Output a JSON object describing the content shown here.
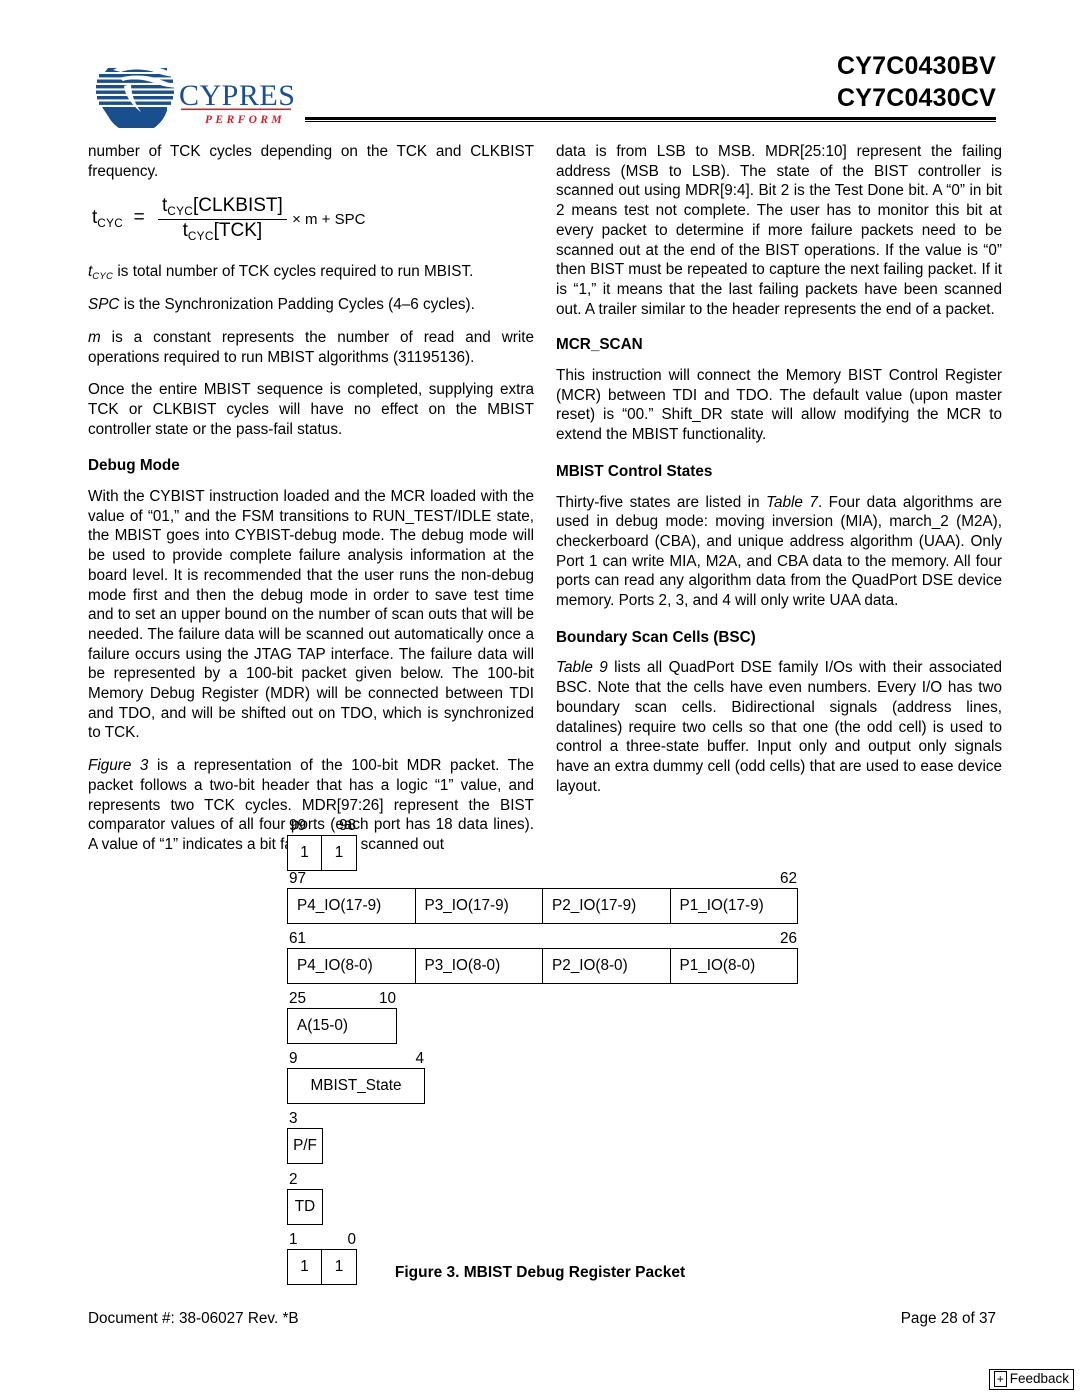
{
  "header": {
    "logo_name": "cypress-logo",
    "logo_wordmark": "CYPRESS",
    "logo_tagline": "PERFORM",
    "title_line1": "CY7C0430BV",
    "title_line2": "CY7C0430CV",
    "brand_blue": "#1a4f8f",
    "brand_red": "#d62027"
  },
  "left_column": {
    "para_intro": "number of TCK cycles depending on the TCK and CLKBIST frequency.",
    "formula": {
      "lhs": "t",
      "lhs_sub": "CYC",
      "equals": "=",
      "numerator": "t",
      "numerator_sub": "CYC",
      "numerator_rest": "[CLKBIST]",
      "denominator": "t",
      "denominator_sub": "CYC",
      "denominator_rest": "[TCK]",
      "tail": "× m + SPC"
    },
    "para_tcyc_def_ital": "t",
    "para_tcyc_def_sub": "CYC",
    "para_tcyc_def_rest": " is total number of TCK cycles required to run MBIST.",
    "para_spc_ital": "SPC",
    "para_spc_rest": " is the Synchronization Padding Cycles (4–6 cycles).",
    "para_m_ital": "m",
    "para_m_rest": " is a constant represents the number of read and write operations required to run MBIST algorithms (31195136).",
    "para_once": "Once the entire MBIST sequence is completed, supplying extra TCK or CLKBIST cycles will have no effect on the MBIST controller state or the pass-fail status.",
    "heading_debug_mode": "Debug Mode",
    "para_debug": "With the CYBIST instruction loaded and the MCR loaded with the value of “01,” and the FSM transitions to RUN_TEST/IDLE state, the MBIST goes into CYBIST-debug mode. The debug mode will be used to provide complete failure analysis information at the board level. It is recommended that the user runs the non-debug mode first and then the debug mode in order to save test time and to set an upper bound on the number of scan outs that will be needed. The failure data will be scanned out automatically once a failure occurs using the JTAG TAP interface. The failure data will be represented by a 100-bit packet given below. The 100-bit Memory Debug Register (MDR) will be connected between TDI and TDO, and will be shifted out on TDO, which is synchronized to TCK.",
    "para_figure3_ital": "Figure 3",
    "para_figure3_rest": " is a representation of the 100-bit MDR packet. The packet follows a two-bit header that has a logic “1” value, and represents two TCK cycles. MDR[97:26] represent the BIST comparator values of all four ports (each port has 18 data lines). A value of “1” indicates a bit failure. The scanned out"
  },
  "right_column": {
    "para_continued": "data is from LSB to MSB. MDR[25:10] represent the failing address (MSB to LSB). The state of the BIST controller is scanned out using MDR[9:4]. Bit 2 is the Test Done bit. A “0” in bit 2 means test not complete. The user has to monitor this bit at every packet to determine if more failure packets need to be scanned out at the end of the BIST operations. If the value is “0” then BIST must be repeated to capture the next failing packet. If it is “1,” it means that the last failing packets have been scanned out. A trailer similar to the header represents the end of a packet.",
    "heading_mcr_scan": "MCR_SCAN",
    "para_mcr_scan": "This instruction will connect the Memory BIST Control Register (MCR) between TDI and TDO. The default value (upon master reset) is “00.” Shift_DR state will allow modifying the MCR to extend the MBIST functionality.",
    "heading_mbist_control": "MBIST Control States",
    "para_mbist_control_pre": "Thirty-five states are listed in ",
    "para_mbist_control_ital": "Table 7",
    "para_mbist_control_rest": ". Four data algorithms are used in debug mode: moving inversion (MIA), march_2 (M2A), checkerboard (CBA), and unique address algorithm (UAA). Only Port 1 can write MIA, M2A, and CBA data to the memory. All four ports can read any algorithm data from the QuadPort DSE device memory. Ports 2, 3, and 4 will only write UAA data.",
    "heading_bsc": "Boundary Scan Cells (BSC)",
    "para_bsc_ital": "Table 9",
    "para_bsc_rest": " lists all QuadPort DSE family I/Os with their associated BSC. Note that the cells have even numbers. Every I/O has two boundary scan cells. Bidirectional signals (address lines, datalines) require two cells so that one (the odd cell) is used to control a three-state buffer. Input only and output only signals have an extra dummy cell (odd cells) that are used to ease device layout."
  },
  "figure": {
    "caption": "Figure 3. MBIST Debug Register Packet",
    "rows": [
      {
        "name": "header-bits",
        "label_left": "99",
        "label_right": "98",
        "cells": [
          "1",
          "1"
        ]
      },
      {
        "name": "io-17-9",
        "label_left": "97",
        "label_right": "62",
        "cells": [
          "P4_IO(17-9)",
          "P3_IO(17-9)",
          "P2_IO(17-9)",
          "P1_IO(17-9)"
        ]
      },
      {
        "name": "io-8-0",
        "label_left": "61",
        "label_right": "26",
        "cells": [
          "P4_IO(8-0)",
          "P3_IO(8-0)",
          "P2_IO(8-0)",
          "P1_IO(8-0)"
        ]
      },
      {
        "name": "address",
        "label_left": "25",
        "label_right": "10",
        "cells": [
          "A(15-0)"
        ]
      },
      {
        "name": "mbist-state",
        "label_left": "9",
        "label_right": "4",
        "cells": [
          "MBIST_State"
        ]
      },
      {
        "name": "pass-fail",
        "label_left": "3",
        "label_right": "",
        "cells": [
          "P/F"
        ]
      },
      {
        "name": "test-done",
        "label_left": "2",
        "label_right": "",
        "cells": [
          "TD"
        ]
      },
      {
        "name": "trailer-bits",
        "label_left": "1",
        "label_right": "0",
        "cells": [
          "1",
          "1"
        ]
      }
    ]
  },
  "footer": {
    "document_id": "Document #: 38-06027 Rev. *B",
    "page_number": "Page 28 of 37",
    "feedback_plus": "+",
    "feedback_label": "Feedback"
  }
}
